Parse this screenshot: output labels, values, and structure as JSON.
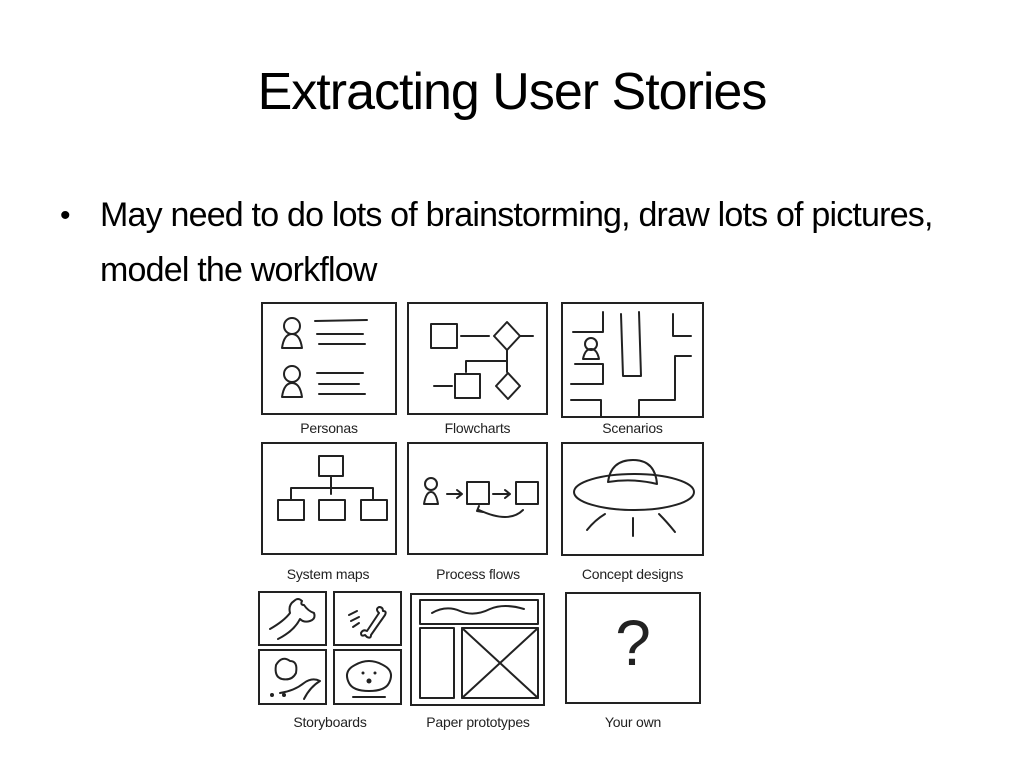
{
  "slide": {
    "title": "Extracting User Stories",
    "bullets": [
      {
        "text": "May need to do lots of brainstorming, draw lots of pictures, model the workflow"
      }
    ],
    "bullet_glyph": "•"
  },
  "figure": {
    "tiles": [
      {
        "id": "personas",
        "caption": "Personas",
        "icon": "personas-icon"
      },
      {
        "id": "flowcharts",
        "caption": "Flowcharts",
        "icon": "flowchart-icon"
      },
      {
        "id": "scenarios",
        "caption": "Scenarios",
        "icon": "scenario-maze-icon"
      },
      {
        "id": "system-maps",
        "caption": "System maps",
        "icon": "hierarchy-icon"
      },
      {
        "id": "process-flows",
        "caption": "Process flows",
        "icon": "process-flow-icon"
      },
      {
        "id": "concept-designs",
        "caption": "Concept designs",
        "icon": "ufo-icon"
      },
      {
        "id": "storyboards",
        "caption": "Storyboards",
        "icon": "storyboard-icon"
      },
      {
        "id": "paper-prototypes",
        "caption": "Paper prototypes",
        "icon": "wireframe-icon"
      },
      {
        "id": "your-own",
        "caption": "Your own",
        "icon": "question-mark-icon",
        "glyph": "?"
      }
    ]
  }
}
